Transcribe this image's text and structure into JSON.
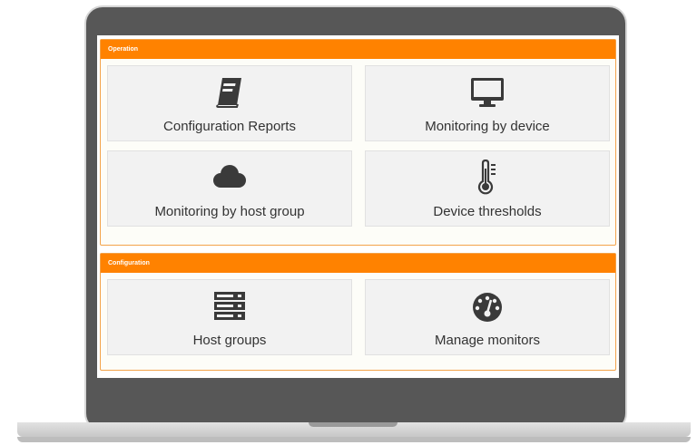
{
  "operation": {
    "title": "Operation",
    "tiles": [
      {
        "label": "Configuration Reports",
        "icon": "book-icon"
      },
      {
        "label": "Monitoring by device",
        "icon": "monitor-icon"
      },
      {
        "label": "Monitoring by host group",
        "icon": "cloud-icon"
      },
      {
        "label": "Device thresholds",
        "icon": "thermometer-icon"
      }
    ]
  },
  "configuration": {
    "title": "Configuration",
    "tiles": [
      {
        "label": "Host groups",
        "icon": "server-icon"
      },
      {
        "label": "Manage monitors",
        "icon": "dashboard-gauge-icon"
      }
    ]
  },
  "colors": {
    "accent": "#ff8200",
    "frame": "#575757",
    "tile_bg": "#f2f2f2",
    "icon": "#3a3a3a"
  }
}
